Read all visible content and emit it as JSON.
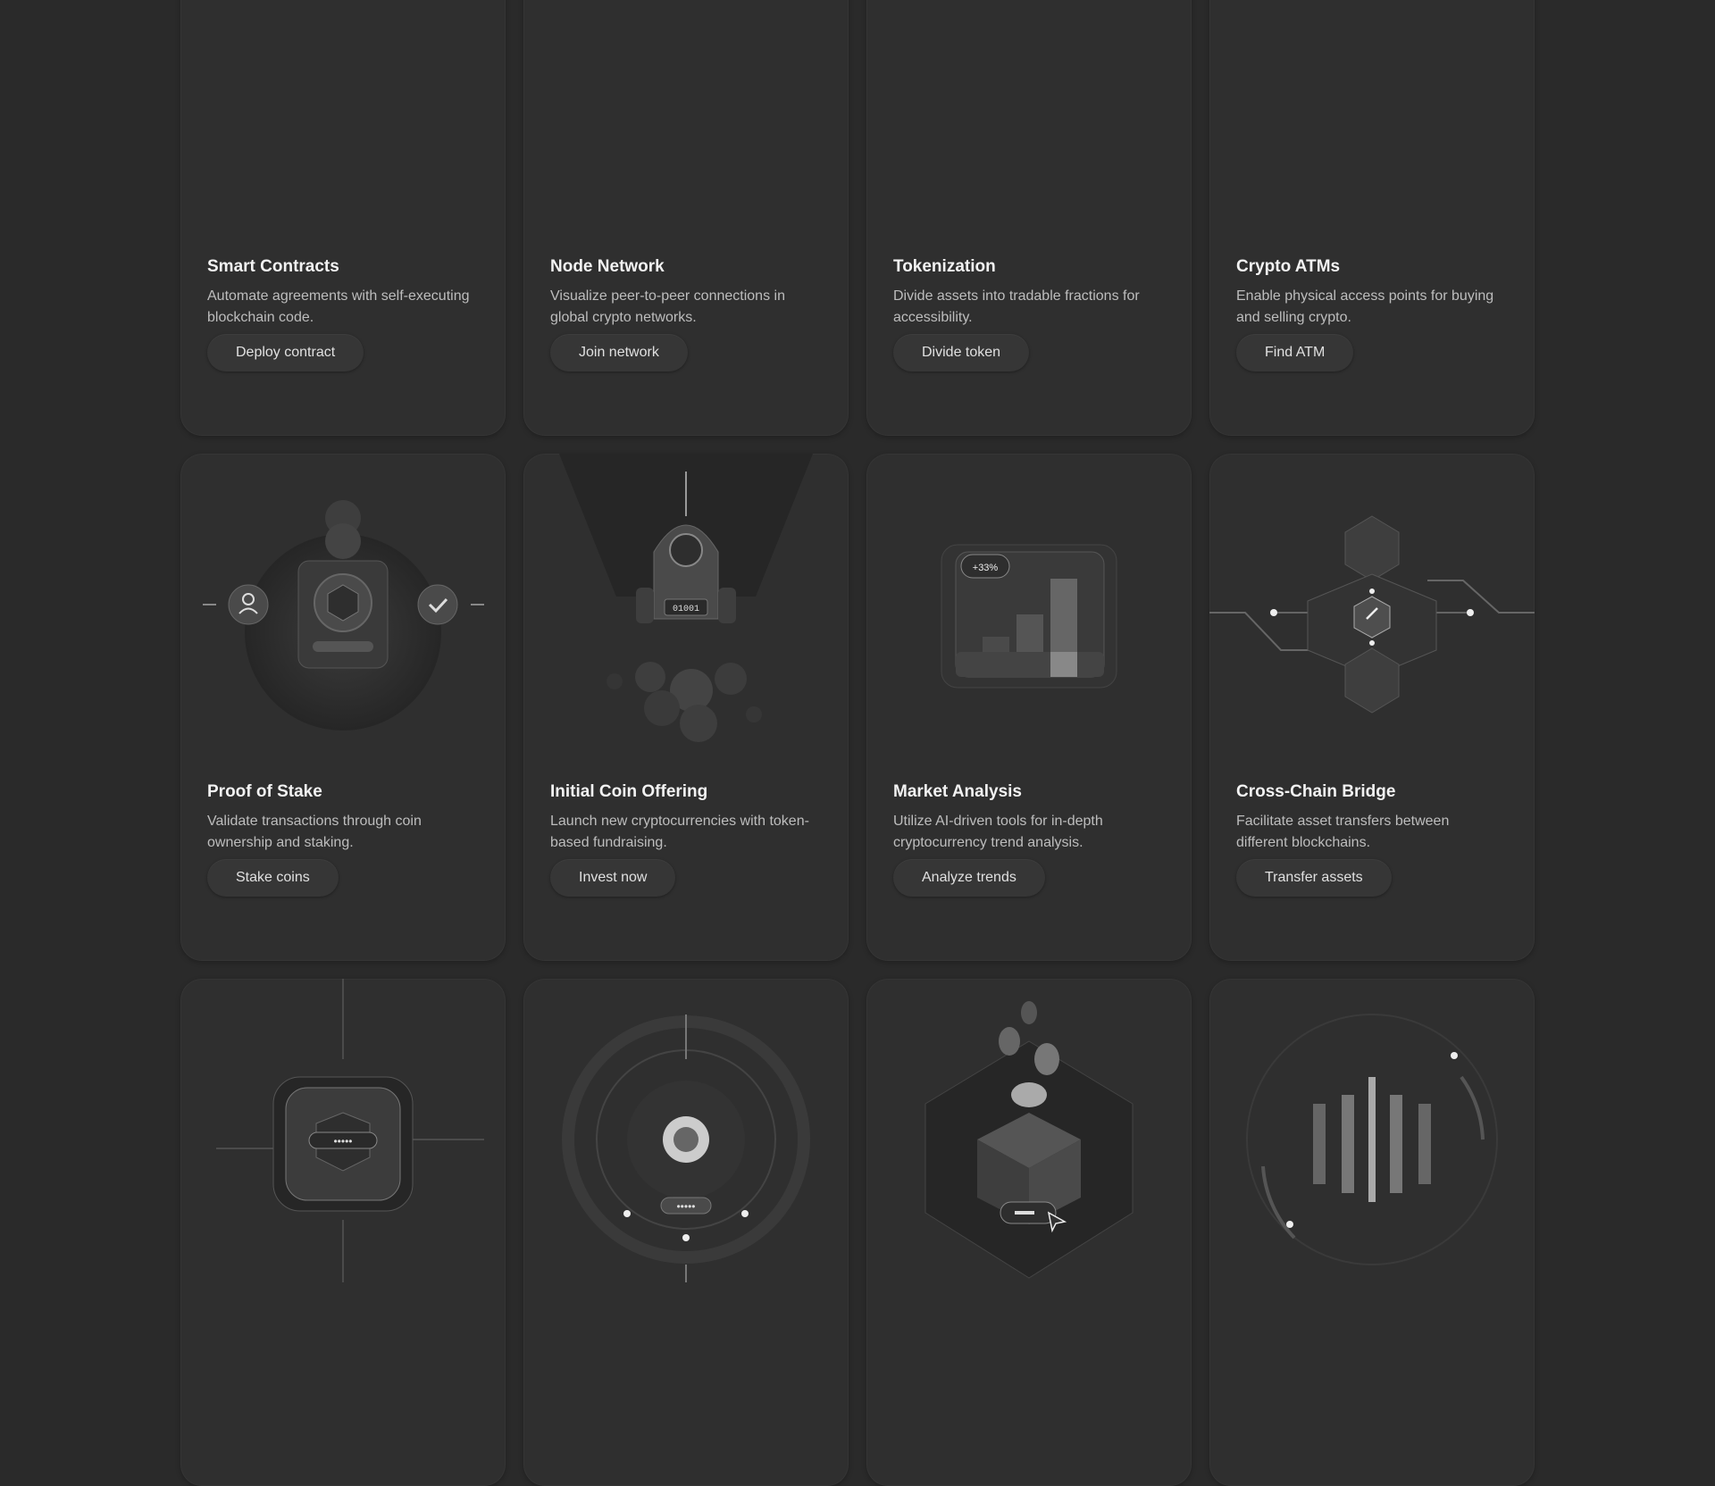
{
  "cards": [
    {
      "title": "Smart Contracts",
      "desc": "Automate agreements with self-executing blockchain code.",
      "button": "Deploy contract"
    },
    {
      "title": "Node Network",
      "desc": "Visualize peer-to-peer connections in global crypto networks.",
      "button": "Join network"
    },
    {
      "title": "Tokenization",
      "desc": "Divide assets into tradable fractions for accessibility.",
      "button": "Divide token"
    },
    {
      "title": "Crypto ATMs",
      "desc": "Enable physical access points for buying and selling crypto.",
      "button": "Find ATM"
    },
    {
      "title": "Proof of Stake",
      "desc": "Validate transactions through coin ownership and staking.",
      "button": "Stake coins"
    },
    {
      "title": "Initial Coin Offering",
      "desc": "Launch new cryptocurrencies with token-based fundraising.",
      "button": "Invest now"
    },
    {
      "title": "Market Analysis",
      "desc": "Utilize AI-driven tools for in-depth cryptocurrency trend analysis.",
      "button": "Analyze trends"
    },
    {
      "title": "Cross-Chain Bridge",
      "desc": "Facilitate asset transfers between different blockchains.",
      "button": "Transfer assets"
    }
  ],
  "illustrations": {
    "ico_code": "01001",
    "market_badge": "+33%",
    "icons": [
      "user-icon",
      "check-icon",
      "rocket-icon",
      "bar-chart-icon",
      "chain-link-icon",
      "chip-icon",
      "gear-icon",
      "box-icon",
      "cursor-icon",
      "equalizer-icon"
    ]
  }
}
